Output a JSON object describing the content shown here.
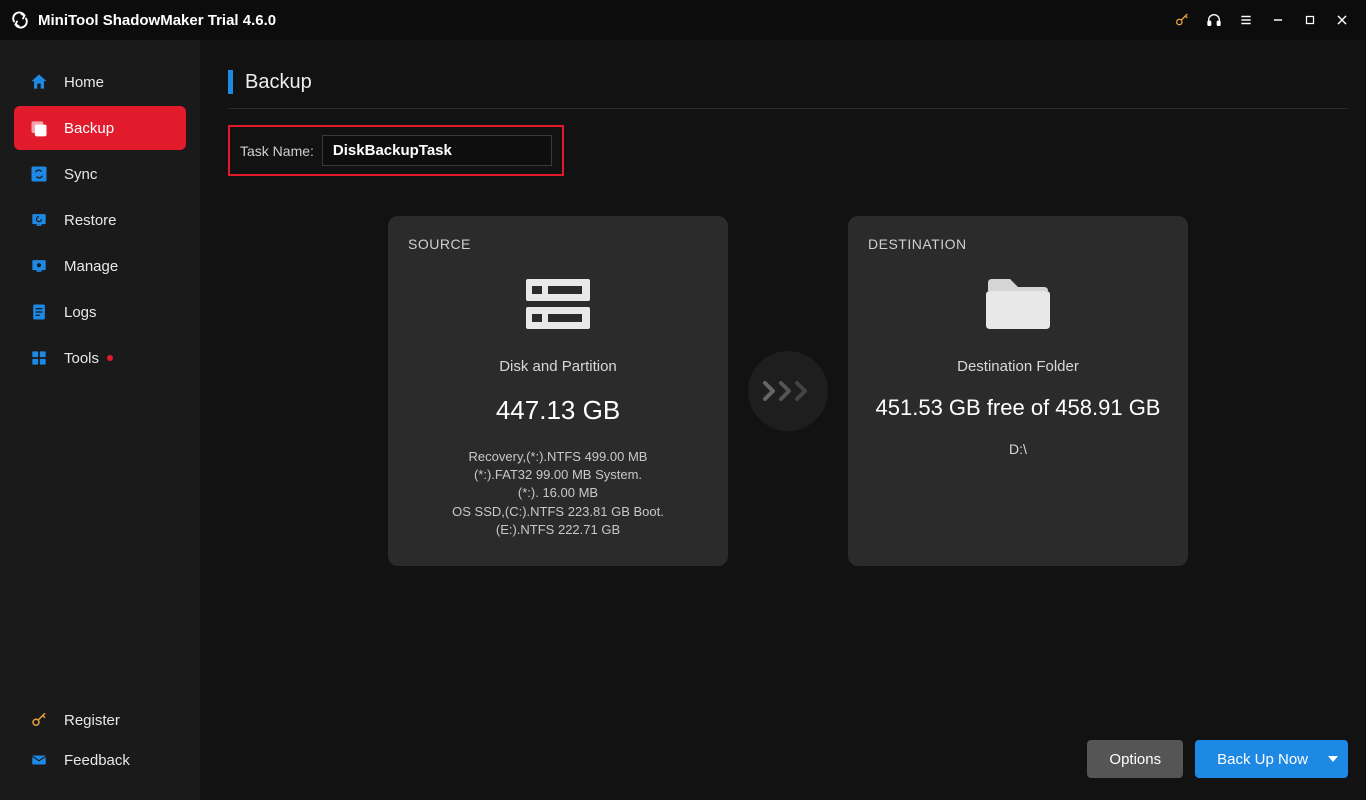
{
  "titlebar": {
    "app_title": "MiniTool ShadowMaker Trial 4.6.0"
  },
  "sidebar": {
    "items": [
      {
        "label": "Home"
      },
      {
        "label": "Backup"
      },
      {
        "label": "Sync"
      },
      {
        "label": "Restore"
      },
      {
        "label": "Manage"
      },
      {
        "label": "Logs"
      },
      {
        "label": "Tools"
      }
    ],
    "footer": {
      "register": "Register",
      "feedback": "Feedback"
    }
  },
  "main": {
    "heading": "Backup",
    "task_name_label": "Task Name:",
    "task_name_value": "DiskBackupTask",
    "source": {
      "title": "SOURCE",
      "subtitle": "Disk and Partition",
      "size": "447.13 GB",
      "lines": [
        "Recovery,(*:).NTFS 499.00 MB",
        "(*:).FAT32 99.00 MB System.",
        "(*:). 16.00 MB",
        "OS SSD,(C:).NTFS 223.81 GB Boot.",
        "(E:).NTFS 222.71 GB"
      ]
    },
    "destination": {
      "title": "DESTINATION",
      "subtitle": "Destination Folder",
      "free_line": "451.53 GB free of 458.91 GB",
      "path": "D:\\"
    },
    "buttons": {
      "options": "Options",
      "backup_now": "Back Up Now"
    }
  }
}
